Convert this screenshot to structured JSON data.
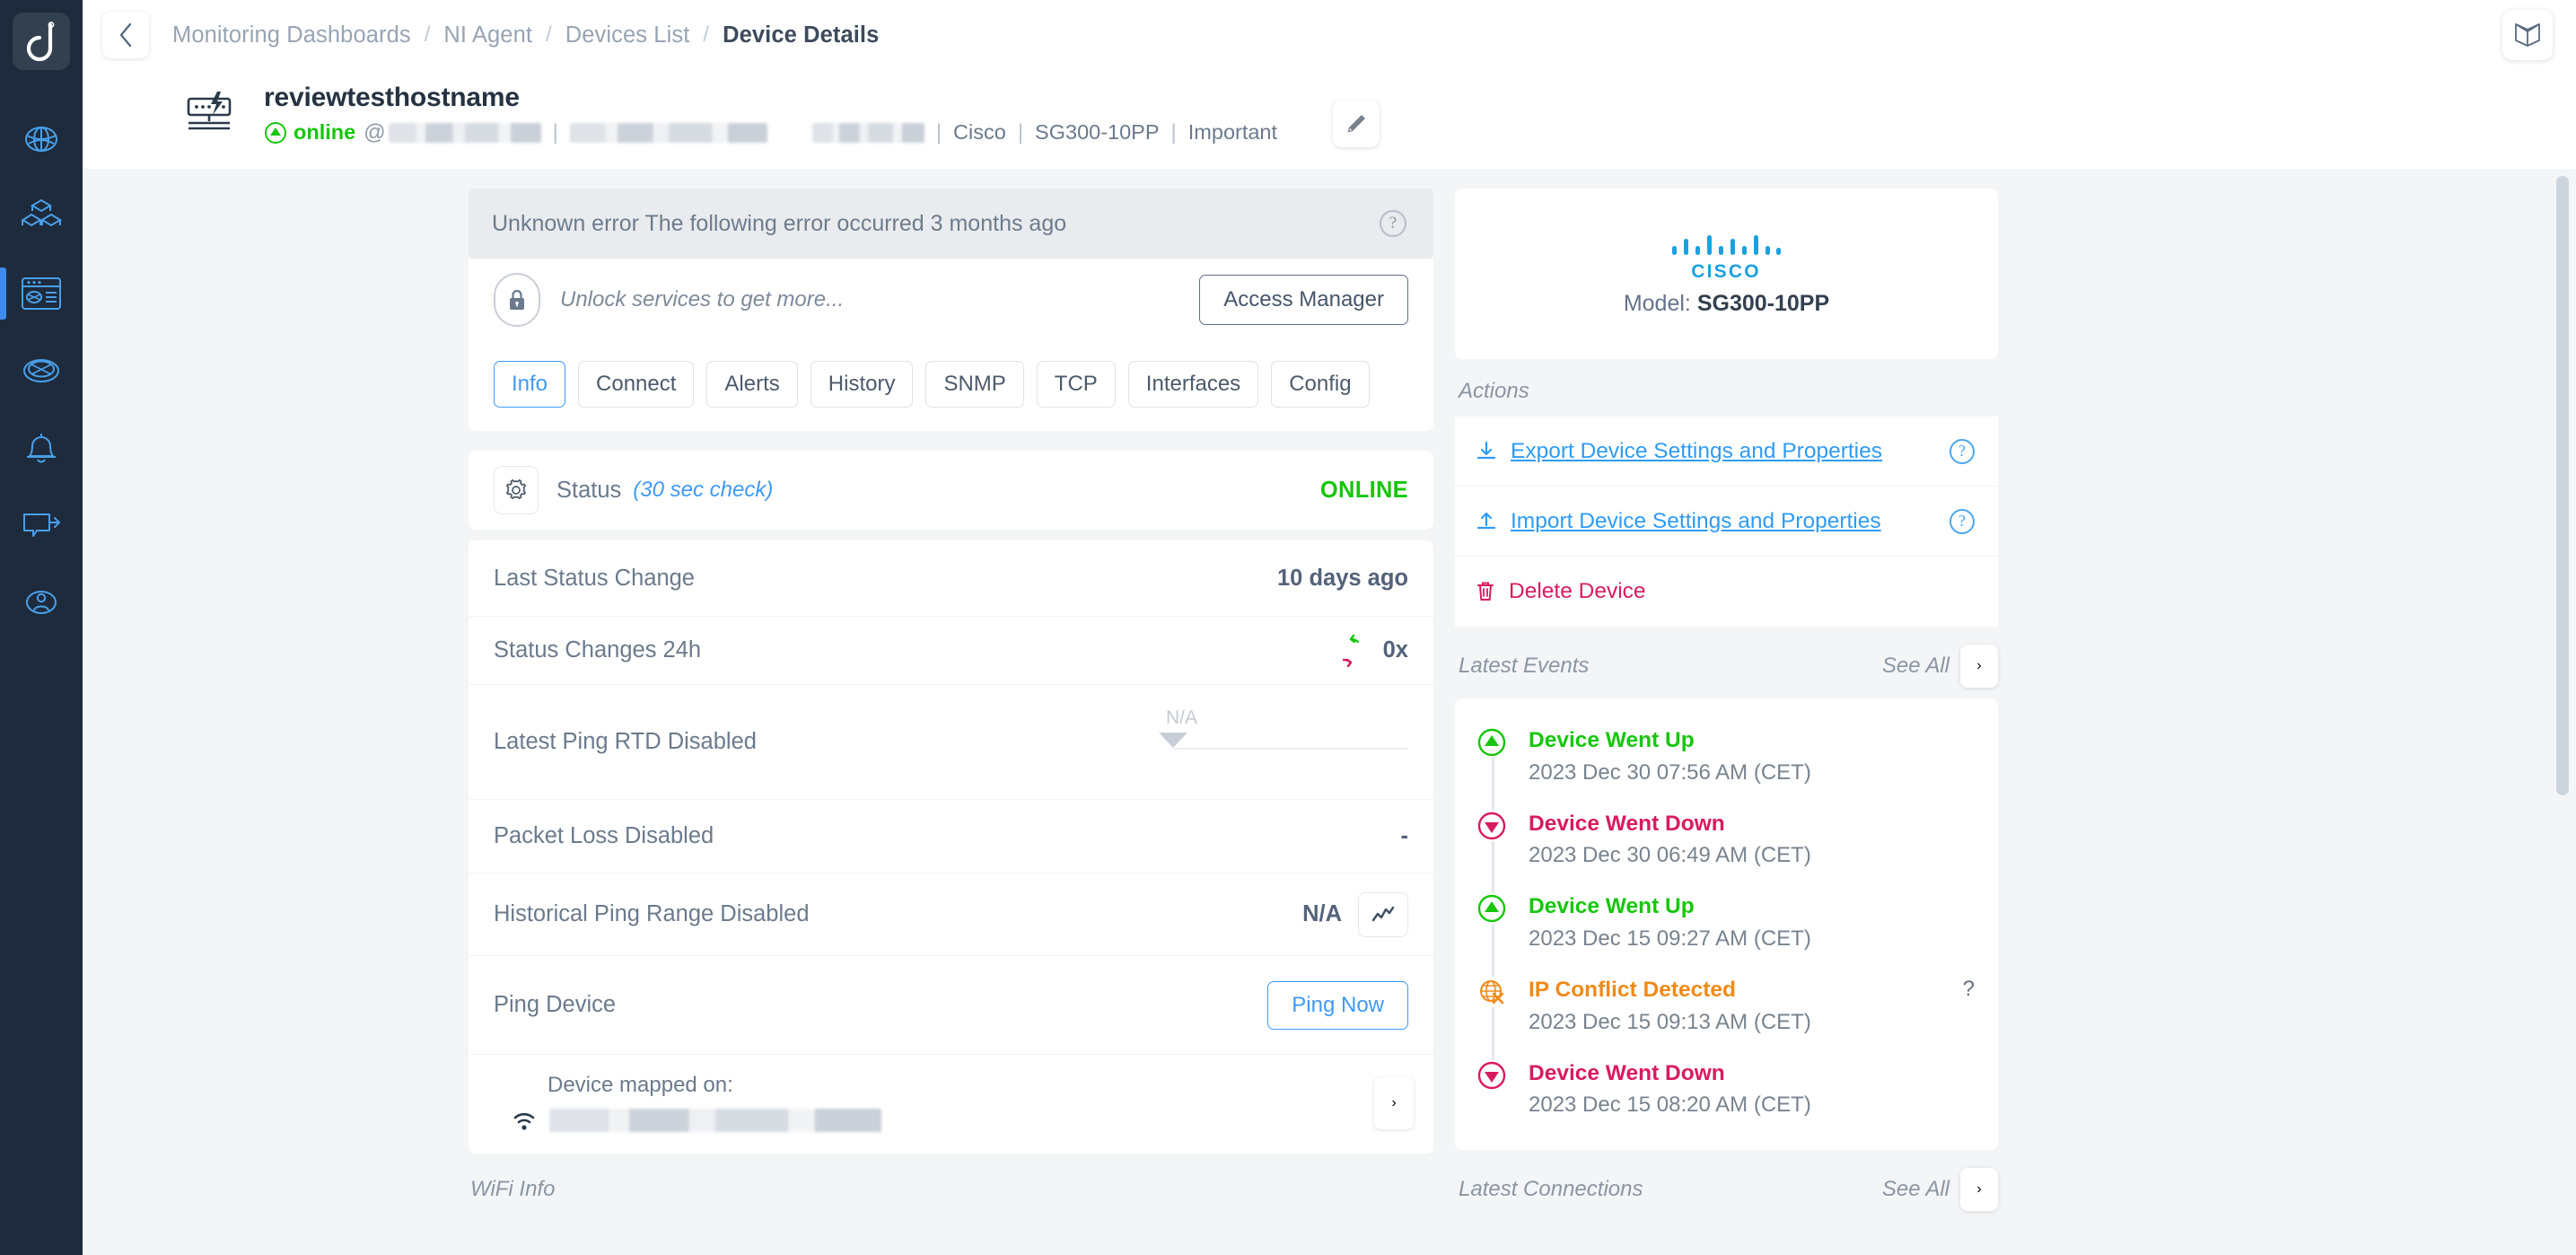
{
  "sidebar": {
    "logo_name": "domotz-logo",
    "items": [
      {
        "icon": "globe-network-icon",
        "name": "sidebar-item-network",
        "active": false
      },
      {
        "icon": "cubes-icon",
        "name": "sidebar-item-inventory",
        "active": false
      },
      {
        "icon": "dashboard-window-icon",
        "name": "sidebar-item-dashboards",
        "active": true
      },
      {
        "icon": "topology-icon",
        "name": "sidebar-item-topology",
        "active": false
      },
      {
        "icon": "bell-icon",
        "name": "sidebar-item-alerts",
        "active": false
      },
      {
        "icon": "share-export-icon",
        "name": "sidebar-item-share",
        "active": false
      },
      {
        "icon": "user-icon",
        "name": "sidebar-item-account",
        "active": false
      }
    ]
  },
  "topbar": {
    "back_label": "‹",
    "breadcrumbs": [
      {
        "label": "Monitoring Dashboards",
        "current": false
      },
      {
        "label": "NI Agent",
        "current": false
      },
      {
        "label": "Devices List",
        "current": false
      },
      {
        "label": "Device Details",
        "current": true
      }
    ],
    "separator": "/",
    "book_icon": "book-icon"
  },
  "device": {
    "name": "reviewtesthostname",
    "status": "online",
    "at": "@",
    "vendor": "Cisco",
    "model": "SG300-10PP",
    "importance": "Important",
    "separator": "|",
    "edit_icon": "pencil-icon"
  },
  "error_banner": {
    "text": "Unknown error The following error occurred 3 months ago",
    "help": "?"
  },
  "unlock": {
    "text": "Unlock services to get more...",
    "button": "Access Manager",
    "lock_icon": "lock-icon"
  },
  "tabs": [
    {
      "label": "Info",
      "active": true
    },
    {
      "label": "Connect",
      "active": false
    },
    {
      "label": "Alerts",
      "active": false
    },
    {
      "label": "History",
      "active": false
    },
    {
      "label": "SNMP",
      "active": false
    },
    {
      "label": "TCP",
      "active": false
    },
    {
      "label": "Interfaces",
      "active": false
    },
    {
      "label": "Config",
      "active": false
    }
  ],
  "status_panel": {
    "label": "Status",
    "sub": "(30 sec check)",
    "value": "ONLINE",
    "gear_icon": "gear-icon"
  },
  "info_rows": {
    "last_status_change_label": "Last Status Change",
    "last_status_change_value": "10 days ago",
    "status_changes_label": "Status Changes 24h",
    "status_changes_value": "0x",
    "latest_ping_label": "Latest Ping RTD Disabled",
    "latest_ping_value": "N/A",
    "packet_loss_label": "Packet Loss Disabled",
    "packet_loss_value": "-",
    "historical_ping_label": "Historical Ping Range Disabled",
    "historical_ping_value": "N/A",
    "ping_device_label": "Ping Device",
    "ping_now_button": "Ping Now"
  },
  "mapped": {
    "title": "Device mapped on:",
    "wifi_icon": "wifi-icon",
    "chevron": "›"
  },
  "wifi_info_label": "WiFi Info",
  "cisco": {
    "brand": "CISCO",
    "model_label": "Model:",
    "model_value": "SG300-10PP",
    "brand_color": "#1ba0e1"
  },
  "actions": {
    "title": "Actions",
    "items": [
      {
        "label": "Export Device Settings and Properties",
        "icon": "download-icon",
        "help": "?",
        "danger": false
      },
      {
        "label": "Import Device Settings and Properties",
        "icon": "upload-icon",
        "help": "?",
        "danger": false
      },
      {
        "label": "Delete Device",
        "icon": "trash-icon",
        "help": "",
        "danger": true
      }
    ]
  },
  "latest_events": {
    "title": "Latest Events",
    "see_all": "See All",
    "chevron": "›",
    "items": [
      {
        "title": "Device Went Up",
        "time": "2023 Dec 30 07:56 AM (CET)",
        "kind": "up",
        "q": ""
      },
      {
        "title": "Device Went Down",
        "time": "2023 Dec 30 06:49 AM (CET)",
        "kind": "down",
        "q": ""
      },
      {
        "title": "Device Went Up",
        "time": "2023 Dec 15 09:27 AM (CET)",
        "kind": "up",
        "q": ""
      },
      {
        "title": "IP Conflict Detected",
        "time": "2023 Dec 15 09:13 AM (CET)",
        "kind": "warn",
        "q": "?"
      },
      {
        "title": "Device Went Down",
        "time": "2023 Dec 15 08:20 AM (CET)",
        "kind": "down",
        "q": ""
      }
    ]
  },
  "latest_connections": {
    "title": "Latest Connections",
    "see_all": "See All",
    "chevron": "›"
  },
  "colors": {
    "accent_blue": "#3e9af5",
    "online_green": "#16c60c",
    "danger_pink": "#d81b60",
    "warn_orange": "#ef8a18",
    "sidebar_bg": "#1e2b3c"
  }
}
